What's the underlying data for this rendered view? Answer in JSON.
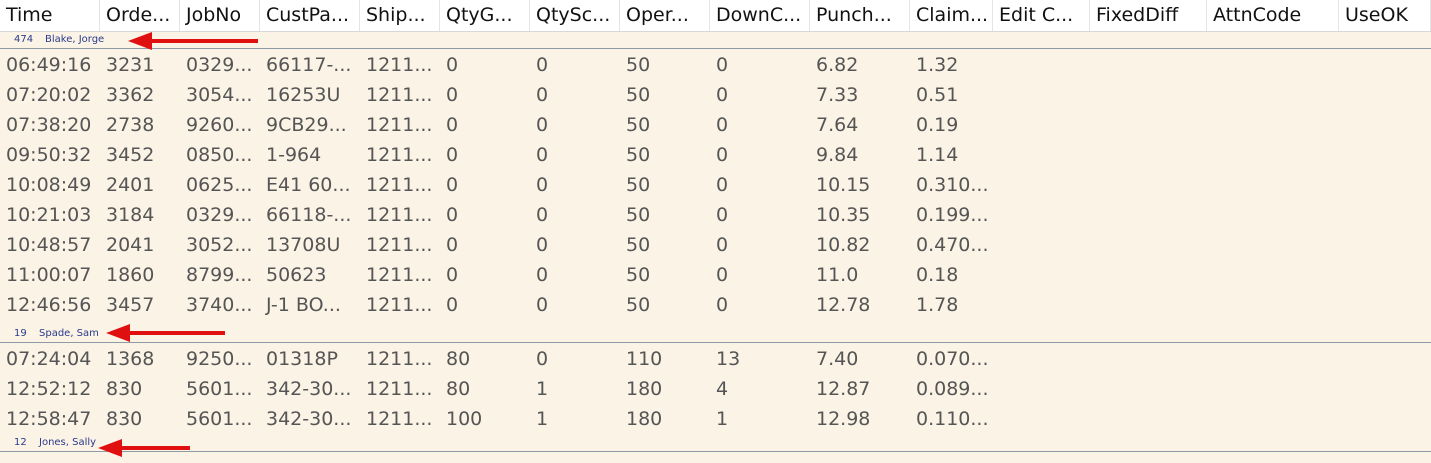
{
  "columns": [
    "Time",
    "Orde...",
    "JobNo",
    "CustPa...",
    "Ship...",
    "QtyG...",
    "QtySc...",
    "Oper...",
    "DownC...",
    "Punch...",
    "Claim...",
    "Edit C...",
    "FixedDiff",
    "AttnCode",
    "UseOK"
  ],
  "groups": [
    {
      "id": "474",
      "name": "Blake, Jorge",
      "rows": [
        [
          "06:49:16",
          "3231",
          "0329...",
          "66117-...",
          "1211...",
          "0",
          "0",
          "50",
          "0",
          "6.82",
          "1.32"
        ],
        [
          "07:20:02",
          "3362",
          "3054...",
          "16253U",
          "1211...",
          "0",
          "0",
          "50",
          "0",
          "7.33",
          "0.51"
        ],
        [
          "07:38:20",
          "2738",
          "9260...",
          "9CB29...",
          "1211...",
          "0",
          "0",
          "50",
          "0",
          "7.64",
          "0.19"
        ],
        [
          "09:50:32",
          "3452",
          "0850...",
          "1-964",
          "1211...",
          "0",
          "0",
          "50",
          "0",
          "9.84",
          "1.14"
        ],
        [
          "10:08:49",
          "2401",
          "0625...",
          "E41 60...",
          "1211...",
          "0",
          "0",
          "50",
          "0",
          "10.15",
          "0.310..."
        ],
        [
          "10:21:03",
          "3184",
          "0329...",
          "66118-...",
          "1211...",
          "0",
          "0",
          "50",
          "0",
          "10.35",
          "0.199..."
        ],
        [
          "10:48:57",
          "2041",
          "3052...",
          "13708U",
          "1211...",
          "0",
          "0",
          "50",
          "0",
          "10.82",
          "0.470..."
        ],
        [
          "11:00:07",
          "1860",
          "8799...",
          "50623",
          "1211...",
          "0",
          "0",
          "50",
          "0",
          "11.0",
          "0.18"
        ],
        [
          "12:46:56",
          "3457",
          "3740...",
          "J-1 BO...",
          "1211...",
          "0",
          "0",
          "50",
          "0",
          "12.78",
          "1.78"
        ]
      ]
    },
    {
      "id": "19",
      "name": "Spade, Sam",
      "rows": [
        [
          "07:24:04",
          "1368",
          "9250...",
          "01318P",
          "1211...",
          "80",
          "0",
          "110",
          "13",
          "7.40",
          "0.070..."
        ],
        [
          "12:52:12",
          "830",
          "5601...",
          "342-30...",
          "1211...",
          "80",
          "1",
          "180",
          "4",
          "12.87",
          "0.089..."
        ],
        [
          "12:58:47",
          "830",
          "5601...",
          "342-30...",
          "1211...",
          "100",
          "1",
          "180",
          "1",
          "12.98",
          "0.110..."
        ]
      ]
    },
    {
      "id": "12",
      "name": "Jones, Sally",
      "rows": []
    }
  ],
  "colors": {
    "background": "#fbf3e6",
    "group_text": "#2a3a8a",
    "arrow": "#e01010"
  }
}
